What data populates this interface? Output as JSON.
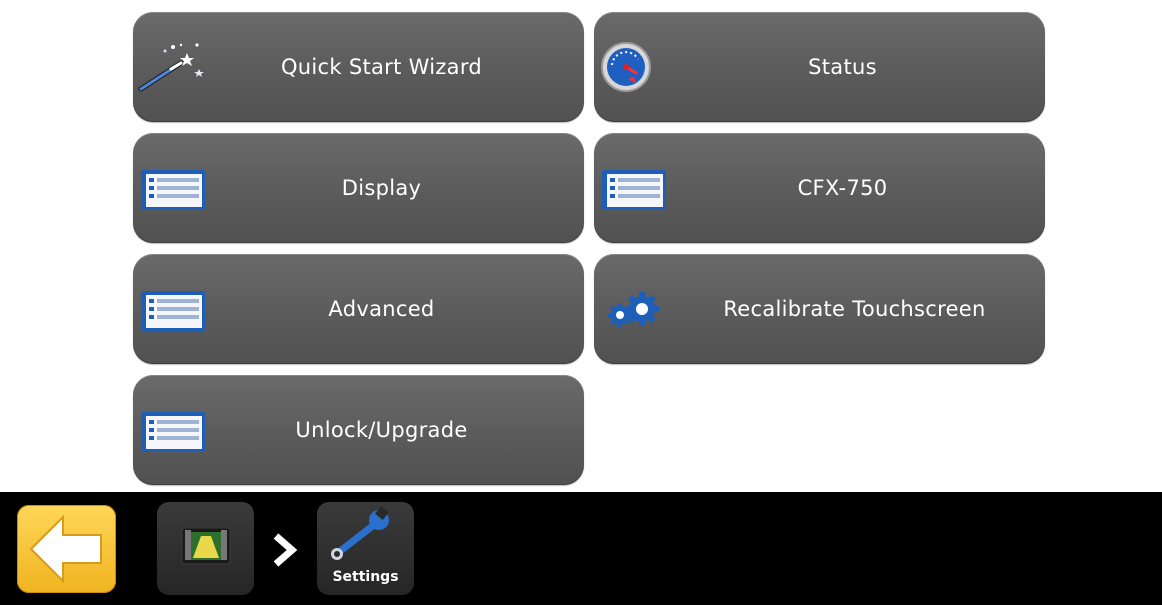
{
  "menu": {
    "quick_start_wizard": {
      "label": "Quick Start Wizard",
      "icon": "magic-wand-icon"
    },
    "status": {
      "label": "Status",
      "icon": "gauge-icon"
    },
    "display": {
      "label": "Display",
      "icon": "list-icon"
    },
    "cfx750": {
      "label": "CFX-750",
      "icon": "list-icon"
    },
    "advanced": {
      "label": "Advanced",
      "icon": "list-icon"
    },
    "recalibrate": {
      "label": "Recalibrate Touchscreen",
      "icon": "gears-icon"
    },
    "unlock_upgrade": {
      "label": "Unlock/Upgrade",
      "icon": "list-icon"
    }
  },
  "bottom_bar": {
    "back_icon": "back-arrow-icon",
    "home_icon": "field-view-icon",
    "separator_icon": "chevron-right-icon",
    "current": {
      "label": "Settings",
      "icon": "wrench-icon"
    }
  },
  "colors": {
    "button_bg": "#5f5f5f",
    "accent_blue": "#1d5fb8",
    "back_button": "#f5c02c",
    "bar_bg": "#000000"
  }
}
